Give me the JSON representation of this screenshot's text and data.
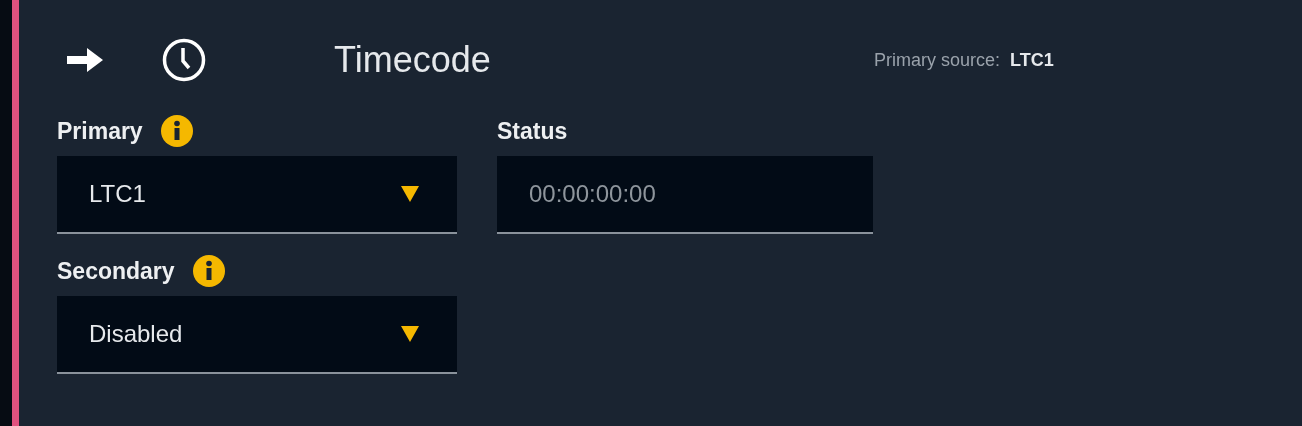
{
  "header": {
    "title": "Timecode",
    "primary_source_label": "Primary source:",
    "primary_source_value": "LTC1"
  },
  "primary": {
    "label": "Primary",
    "value": "LTC1"
  },
  "status": {
    "label": "Status",
    "value": "00:00:00:00"
  },
  "secondary": {
    "label": "Secondary",
    "value": "Disabled"
  }
}
